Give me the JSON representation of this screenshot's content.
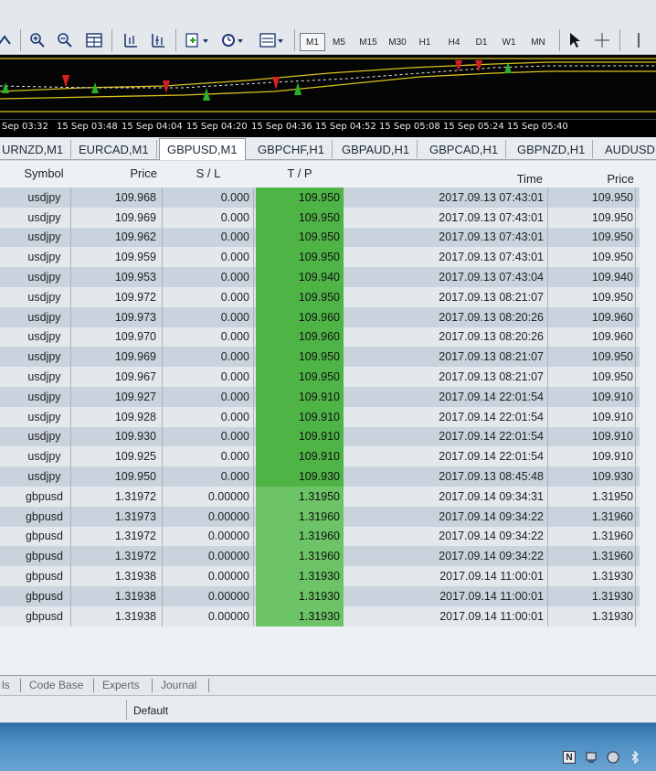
{
  "toolbar": {
    "timeframes": [
      "M1",
      "M5",
      "M15",
      "M30",
      "H1",
      "H4",
      "D1",
      "W1",
      "MN"
    ],
    "active_timeframe": "M1"
  },
  "chart": {
    "time_labels": [
      "Sep 03:32",
      "15 Sep 03:48",
      "15 Sep 04:04",
      "15 Sep 04:20",
      "15 Sep 04:36",
      "15 Sep 04:52",
      "15 Sep 05:08",
      "15 Sep 05:24",
      "15 Sep 05:40"
    ]
  },
  "tabs": [
    "URNZD,M1",
    "EURCAD,M1",
    "GBPUSD,M1",
    "GBPCHF,H1",
    "GBPAUD,H1",
    "GBPCAD,H1",
    "GBPNZD,H1",
    "AUDUSD,"
  ],
  "active_tab": "GBPUSD,M1",
  "table": {
    "headers": {
      "symbol": "Symbol",
      "price": "Price",
      "sl": "S / L",
      "tp": "T / P",
      "time": "Time",
      "close_price": "Price"
    },
    "rows": [
      {
        "symbol": "usdjpy",
        "price": "109.968",
        "sl": "0.000",
        "tp": "109.950",
        "time": "2017.09.13 07:43:01",
        "close": "109.950"
      },
      {
        "symbol": "usdjpy",
        "price": "109.969",
        "sl": "0.000",
        "tp": "109.950",
        "time": "2017.09.13 07:43:01",
        "close": "109.950"
      },
      {
        "symbol": "usdjpy",
        "price": "109.962",
        "sl": "0.000",
        "tp": "109.950",
        "time": "2017.09.13 07:43:01",
        "close": "109.950"
      },
      {
        "symbol": "usdjpy",
        "price": "109.959",
        "sl": "0.000",
        "tp": "109.950",
        "time": "2017.09.13 07:43:01",
        "close": "109.950"
      },
      {
        "symbol": "usdjpy",
        "price": "109.953",
        "sl": "0.000",
        "tp": "109.940",
        "time": "2017.09.13 07:43:04",
        "close": "109.940"
      },
      {
        "symbol": "usdjpy",
        "price": "109.972",
        "sl": "0.000",
        "tp": "109.950",
        "time": "2017.09.13 08:21:07",
        "close": "109.950"
      },
      {
        "symbol": "usdjpy",
        "price": "109.973",
        "sl": "0.000",
        "tp": "109.960",
        "time": "2017.09.13 08:20:26",
        "close": "109.960"
      },
      {
        "symbol": "usdjpy",
        "price": "109.970",
        "sl": "0.000",
        "tp": "109.960",
        "time": "2017.09.13 08:20:26",
        "close": "109.960"
      },
      {
        "symbol": "usdjpy",
        "price": "109.969",
        "sl": "0.000",
        "tp": "109.950",
        "time": "2017.09.13 08:21:07",
        "close": "109.950"
      },
      {
        "symbol": "usdjpy",
        "price": "109.967",
        "sl": "0.000",
        "tp": "109.950",
        "time": "2017.09.13 08:21:07",
        "close": "109.950"
      },
      {
        "symbol": "usdjpy",
        "price": "109.927",
        "sl": "0.000",
        "tp": "109.910",
        "time": "2017.09.14 22:01:54",
        "close": "109.910"
      },
      {
        "symbol": "usdjpy",
        "price": "109.928",
        "sl": "0.000",
        "tp": "109.910",
        "time": "2017.09.14 22:01:54",
        "close": "109.910"
      },
      {
        "symbol": "usdjpy",
        "price": "109.930",
        "sl": "0.000",
        "tp": "109.910",
        "time": "2017.09.14 22:01:54",
        "close": "109.910"
      },
      {
        "symbol": "usdjpy",
        "price": "109.925",
        "sl": "0.000",
        "tp": "109.910",
        "time": "2017.09.14 22:01:54",
        "close": "109.910"
      },
      {
        "symbol": "usdjpy",
        "price": "109.950",
        "sl": "0.000",
        "tp": "109.930",
        "time": "2017.09.13 08:45:48",
        "close": "109.930"
      },
      {
        "symbol": "gbpusd",
        "price": "1.31972",
        "sl": "0.00000",
        "tp": "1.31950",
        "time": "2017.09.14 09:34:31",
        "close": "1.31950"
      },
      {
        "symbol": "gbpusd",
        "price": "1.31973",
        "sl": "0.00000",
        "tp": "1.31960",
        "time": "2017.09.14 09:34:22",
        "close": "1.31960"
      },
      {
        "symbol": "gbpusd",
        "price": "1.31972",
        "sl": "0.00000",
        "tp": "1.31960",
        "time": "2017.09.14 09:34:22",
        "close": "1.31960"
      },
      {
        "symbol": "gbpusd",
        "price": "1.31972",
        "sl": "0.00000",
        "tp": "1.31960",
        "time": "2017.09.14 09:34:22",
        "close": "1.31960"
      },
      {
        "symbol": "gbpusd",
        "price": "1.31938",
        "sl": "0.00000",
        "tp": "1.31930",
        "time": "2017.09.14 11:00:01",
        "close": "1.31930"
      },
      {
        "symbol": "gbpusd",
        "price": "1.31938",
        "sl": "0.00000",
        "tp": "1.31930",
        "time": "2017.09.14 11:00:01",
        "close": "1.31930"
      },
      {
        "symbol": "gbpusd",
        "price": "1.31938",
        "sl": "0.00000",
        "tp": "1.31930",
        "time": "2017.09.14 11:00:01",
        "close": "1.31930"
      }
    ]
  },
  "bottom_tabs": [
    "ls",
    "Code Base",
    "Experts",
    "Journal"
  ],
  "status": {
    "profile": "Default"
  },
  "colors": {
    "tp_fill": "#4fb446",
    "row_alt": "#c9d3dd",
    "chart_bg": "#050505"
  }
}
